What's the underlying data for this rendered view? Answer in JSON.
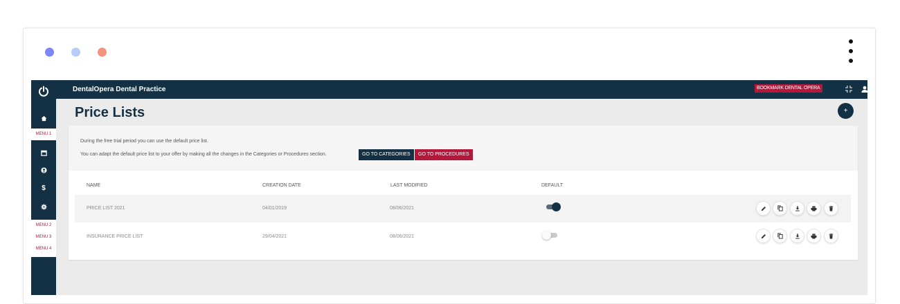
{
  "window": {
    "dot_colors": [
      "#7b87f4",
      "#b3cdf6",
      "#f7937a"
    ]
  },
  "topbar": {
    "brand": "DentalOpera Dental Practice",
    "bookmark_label": "BOOKMARK DENTAL OPERA"
  },
  "sidebar": {
    "menu1": "MENU 1",
    "menu2": "MENU 2",
    "menu3": "MENU 3",
    "menu4": "MENU 4"
  },
  "page": {
    "title": "Price Lists",
    "add_label": "+"
  },
  "notice": {
    "line1": "During the free trial period you can use the default price list.",
    "line2": "You can adapt the default price list to your offer by making all the changes in the Categories or Procedures section.",
    "btn_categories": "GO TO CATEGORIES",
    "btn_procedures": "GO TO PROCEDURES"
  },
  "table": {
    "headers": {
      "name": "NAME",
      "creation": "CREATION DATE",
      "modified": "LAST MODIFIED",
      "default": "DEFAULT"
    },
    "rows": [
      {
        "name": "PRICE LIST 2021",
        "created": "04/01/2019",
        "modified": "08/06/2021",
        "default": true
      },
      {
        "name": "INSURANCE PRICE LIST",
        "created": "29/04/2021",
        "modified": "08/06/2021",
        "default": false
      }
    ]
  },
  "colors": {
    "navy": "#133044",
    "crimson": "#b3173c"
  }
}
